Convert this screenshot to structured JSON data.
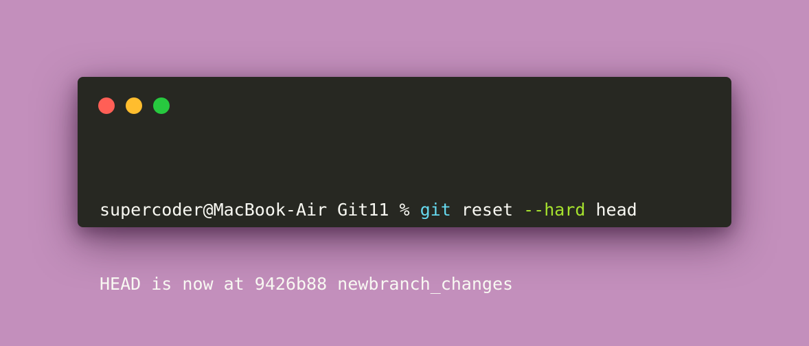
{
  "window": {
    "controls": {
      "close_color": "#ff5f56",
      "minimize_color": "#ffbd2e",
      "maximize_color": "#27c93f"
    }
  },
  "terminal": {
    "line1": {
      "prompt": "supercoder@MacBook-Air Git11 % ",
      "command": "git",
      "arg1": " reset ",
      "flag": "--hard",
      "arg2": " head"
    },
    "line2": {
      "output": "HEAD is now at 9426b88 newbranch_changes"
    },
    "colors": {
      "background": "#272822",
      "text": "#f8f8f2",
      "command": "#66d9ef",
      "flag": "#a6e22e"
    }
  }
}
